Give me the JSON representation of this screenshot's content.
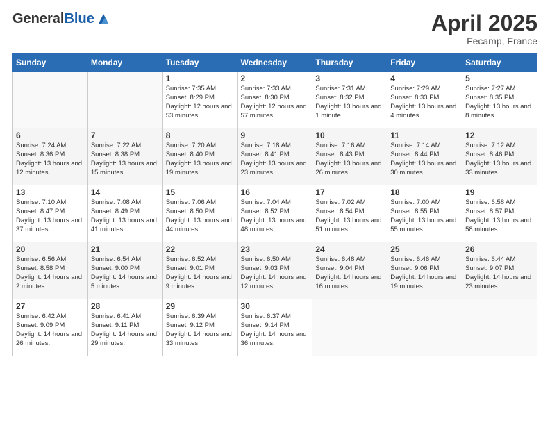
{
  "logo": {
    "general": "General",
    "blue": "Blue"
  },
  "title": {
    "month": "April 2025",
    "location": "Fecamp, France"
  },
  "headers": [
    "Sunday",
    "Monday",
    "Tuesday",
    "Wednesday",
    "Thursday",
    "Friday",
    "Saturday"
  ],
  "weeks": [
    [
      {
        "day": "",
        "info": ""
      },
      {
        "day": "",
        "info": ""
      },
      {
        "day": "1",
        "info": "Sunrise: 7:35 AM\nSunset: 8:29 PM\nDaylight: 12 hours and 53 minutes."
      },
      {
        "day": "2",
        "info": "Sunrise: 7:33 AM\nSunset: 8:30 PM\nDaylight: 12 hours and 57 minutes."
      },
      {
        "day": "3",
        "info": "Sunrise: 7:31 AM\nSunset: 8:32 PM\nDaylight: 13 hours and 1 minute."
      },
      {
        "day": "4",
        "info": "Sunrise: 7:29 AM\nSunset: 8:33 PM\nDaylight: 13 hours and 4 minutes."
      },
      {
        "day": "5",
        "info": "Sunrise: 7:27 AM\nSunset: 8:35 PM\nDaylight: 13 hours and 8 minutes."
      }
    ],
    [
      {
        "day": "6",
        "info": "Sunrise: 7:24 AM\nSunset: 8:36 PM\nDaylight: 13 hours and 12 minutes."
      },
      {
        "day": "7",
        "info": "Sunrise: 7:22 AM\nSunset: 8:38 PM\nDaylight: 13 hours and 15 minutes."
      },
      {
        "day": "8",
        "info": "Sunrise: 7:20 AM\nSunset: 8:40 PM\nDaylight: 13 hours and 19 minutes."
      },
      {
        "day": "9",
        "info": "Sunrise: 7:18 AM\nSunset: 8:41 PM\nDaylight: 13 hours and 23 minutes."
      },
      {
        "day": "10",
        "info": "Sunrise: 7:16 AM\nSunset: 8:43 PM\nDaylight: 13 hours and 26 minutes."
      },
      {
        "day": "11",
        "info": "Sunrise: 7:14 AM\nSunset: 8:44 PM\nDaylight: 13 hours and 30 minutes."
      },
      {
        "day": "12",
        "info": "Sunrise: 7:12 AM\nSunset: 8:46 PM\nDaylight: 13 hours and 33 minutes."
      }
    ],
    [
      {
        "day": "13",
        "info": "Sunrise: 7:10 AM\nSunset: 8:47 PM\nDaylight: 13 hours and 37 minutes."
      },
      {
        "day": "14",
        "info": "Sunrise: 7:08 AM\nSunset: 8:49 PM\nDaylight: 13 hours and 41 minutes."
      },
      {
        "day": "15",
        "info": "Sunrise: 7:06 AM\nSunset: 8:50 PM\nDaylight: 13 hours and 44 minutes."
      },
      {
        "day": "16",
        "info": "Sunrise: 7:04 AM\nSunset: 8:52 PM\nDaylight: 13 hours and 48 minutes."
      },
      {
        "day": "17",
        "info": "Sunrise: 7:02 AM\nSunset: 8:54 PM\nDaylight: 13 hours and 51 minutes."
      },
      {
        "day": "18",
        "info": "Sunrise: 7:00 AM\nSunset: 8:55 PM\nDaylight: 13 hours and 55 minutes."
      },
      {
        "day": "19",
        "info": "Sunrise: 6:58 AM\nSunset: 8:57 PM\nDaylight: 13 hours and 58 minutes."
      }
    ],
    [
      {
        "day": "20",
        "info": "Sunrise: 6:56 AM\nSunset: 8:58 PM\nDaylight: 14 hours and 2 minutes."
      },
      {
        "day": "21",
        "info": "Sunrise: 6:54 AM\nSunset: 9:00 PM\nDaylight: 14 hours and 5 minutes."
      },
      {
        "day": "22",
        "info": "Sunrise: 6:52 AM\nSunset: 9:01 PM\nDaylight: 14 hours and 9 minutes."
      },
      {
        "day": "23",
        "info": "Sunrise: 6:50 AM\nSunset: 9:03 PM\nDaylight: 14 hours and 12 minutes."
      },
      {
        "day": "24",
        "info": "Sunrise: 6:48 AM\nSunset: 9:04 PM\nDaylight: 14 hours and 16 minutes."
      },
      {
        "day": "25",
        "info": "Sunrise: 6:46 AM\nSunset: 9:06 PM\nDaylight: 14 hours and 19 minutes."
      },
      {
        "day": "26",
        "info": "Sunrise: 6:44 AM\nSunset: 9:07 PM\nDaylight: 14 hours and 23 minutes."
      }
    ],
    [
      {
        "day": "27",
        "info": "Sunrise: 6:42 AM\nSunset: 9:09 PM\nDaylight: 14 hours and 26 minutes."
      },
      {
        "day": "28",
        "info": "Sunrise: 6:41 AM\nSunset: 9:11 PM\nDaylight: 14 hours and 29 minutes."
      },
      {
        "day": "29",
        "info": "Sunrise: 6:39 AM\nSunset: 9:12 PM\nDaylight: 14 hours and 33 minutes."
      },
      {
        "day": "30",
        "info": "Sunrise: 6:37 AM\nSunset: 9:14 PM\nDaylight: 14 hours and 36 minutes."
      },
      {
        "day": "",
        "info": ""
      },
      {
        "day": "",
        "info": ""
      },
      {
        "day": "",
        "info": ""
      }
    ]
  ]
}
